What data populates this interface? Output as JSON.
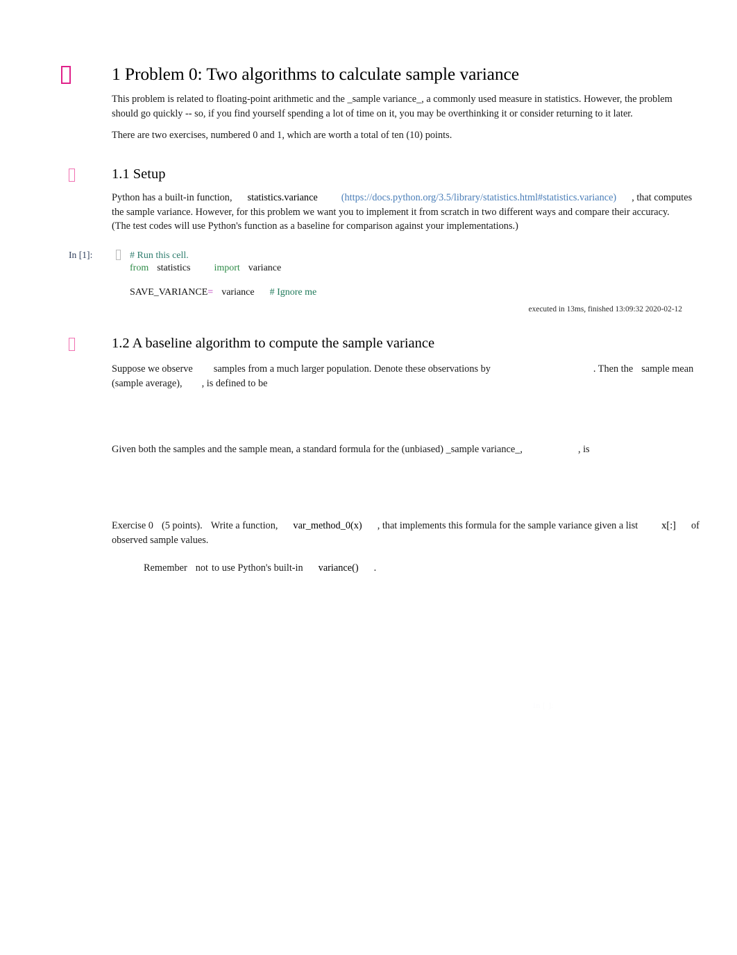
{
  "document": {
    "title": "1 Problem 0: Two algorithms to calculate sample variance"
  },
  "anchors": {
    "h1_icon": "anchor-link-icon",
    "h2_icon": "anchor-link-icon"
  },
  "section1": {
    "heading": "1 Problem 0: Two algorithms to calculate sample variance",
    "para1_line1": "This problem is related to floating-point arithmetic and the _sample variance_, a commonly used measure in statistics. However, the problem",
    "para1_line2": "should go quickly -- so, if you find yourself spending a lot of time on it, you may be overthinking it or consider returning to it later.",
    "para2": "There are two exercises, numbered 0 and 1, which are worth a total of ten (10) points."
  },
  "section1_1": {
    "heading": "1.1 Setup",
    "para_part1": "Python has a built-in function,",
    "inline_code": "statistics.variance",
    "link_text": "(https://docs.python.org/3.5/library/statistics.html#statistics.variance)",
    "para_part2": ", that computes",
    "para_line2": "the sample variance. However, for this problem we want you to implement it from scratch in two different ways and compare their accuracy.",
    "para_line3": "(The test codes will use Python's function as a baseline for comparison against your implementations.)"
  },
  "cell1": {
    "prompt": "In [1]:",
    "tofu_icon": "cell-anchor-icon",
    "code": {
      "line1_comment": "# Run this cell.",
      "line2_kw_from": "from",
      "line2_module": "statistics",
      "line2_kw_import": "import",
      "line2_name": "variance",
      "line3_blank": " ",
      "line4_var": "SAVE_VARIANCE",
      "line4_op": "=",
      "line4_value": "variance",
      "line4_comment": "# Ignore me"
    },
    "exec_info": "executed in 13ms, finished 13:09:32 2020-02-12"
  },
  "section1_2": {
    "heading": "1.2 A baseline algorithm to compute the sample variance",
    "para1_a": "Suppose we observe",
    "para1_math_n": "",
    "para1_b": "samples from a much larger population. Denote these observations by",
    "para1_math_x": "",
    "para1_c": ". Then the",
    "para1_d": "sample mean",
    "para1_line2_a": "(sample average),",
    "para1_math_mean": "",
    "para1_line2_b": ", is defined to be",
    "display_math_1": "",
    "para2_a": "Given both the samples and the sample mean, a standard formula for the (unbiased) _sample variance_,",
    "para2_math_s2": "",
    "para2_b": ", is",
    "display_math_2": ""
  },
  "exercise0": {
    "label": "Exercise 0",
    "points": "(5 points).",
    "text_a": "Write a function,",
    "code_fn": "var_method_0(x)",
    "text_b": ", that implements this formula for the sample variance given a list",
    "code_list": "x[:]",
    "text_c": "of",
    "text_line2": "observed sample values.",
    "quote_a": "Remember",
    "quote_em": "not",
    "quote_b": "to use Python's built-in",
    "quote_code": "variance()",
    "quote_c": "."
  },
  "artifact": {
    "ghost_text": "In [ ]:"
  },
  "colors": {
    "anchor_h1": "#e0218a",
    "anchor_h2": "#f06fb0",
    "link": "#4a7eb8",
    "prompt": "#303f5c",
    "code_keyword": "#2e8b47",
    "code_comment": "#2e7d6e",
    "code_operator": "#b429b4"
  }
}
